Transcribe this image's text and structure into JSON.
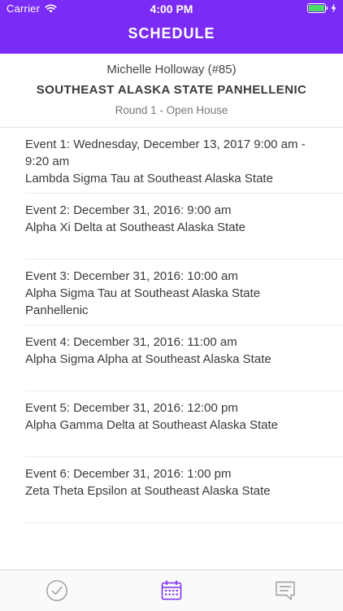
{
  "status_bar": {
    "carrier": "Carrier",
    "time": "4:00 PM",
    "wifi_icon": "wifi-icon",
    "battery_icon": "battery-icon",
    "charging_icon": "charging-bolt-icon"
  },
  "nav": {
    "title": "SCHEDULE"
  },
  "header": {
    "member": "Michelle Holloway (#85)",
    "chapter": "SOUTHEAST ALASKA STATE PANHELLENIC",
    "round": "Round 1 - Open House"
  },
  "events": [
    {
      "when": "Event 1: Wednesday, December 13, 2017 9:00 am - 9:20 am",
      "where": "Lambda Sigma Tau at Southeast Alaska State"
    },
    {
      "when": "Event 2: December 31, 2016: 9:00 am",
      "where": "Alpha Xi Delta at Southeast Alaska State"
    },
    {
      "when": "Event 3: December 31, 2016: 10:00 am",
      "where": "Alpha Sigma Tau at Southeast Alaska State Panhellenic"
    },
    {
      "when": "Event 4: December 31, 2016: 11:00 am",
      "where": "Alpha Sigma Alpha at Southeast Alaska State"
    },
    {
      "when": "Event 5: December 31, 2016: 12:00 pm",
      "where": "Alpha Gamma Delta at Southeast Alaska State"
    },
    {
      "when": "Event 6: December 31, 2016: 1:00 pm",
      "where": "Zeta Theta Epsilon at Southeast Alaska State"
    }
  ],
  "tabbar": {
    "tabs": [
      {
        "icon": "checkmark-circle-icon",
        "active": false
      },
      {
        "icon": "calendar-icon",
        "active": true
      },
      {
        "icon": "message-bubble-icon",
        "active": false
      }
    ],
    "active_color": "#7a2bf5",
    "inactive_color": "#9a9a9a"
  },
  "colors": {
    "brand": "#7a2bf5",
    "battery_fill": "#4cd964"
  }
}
